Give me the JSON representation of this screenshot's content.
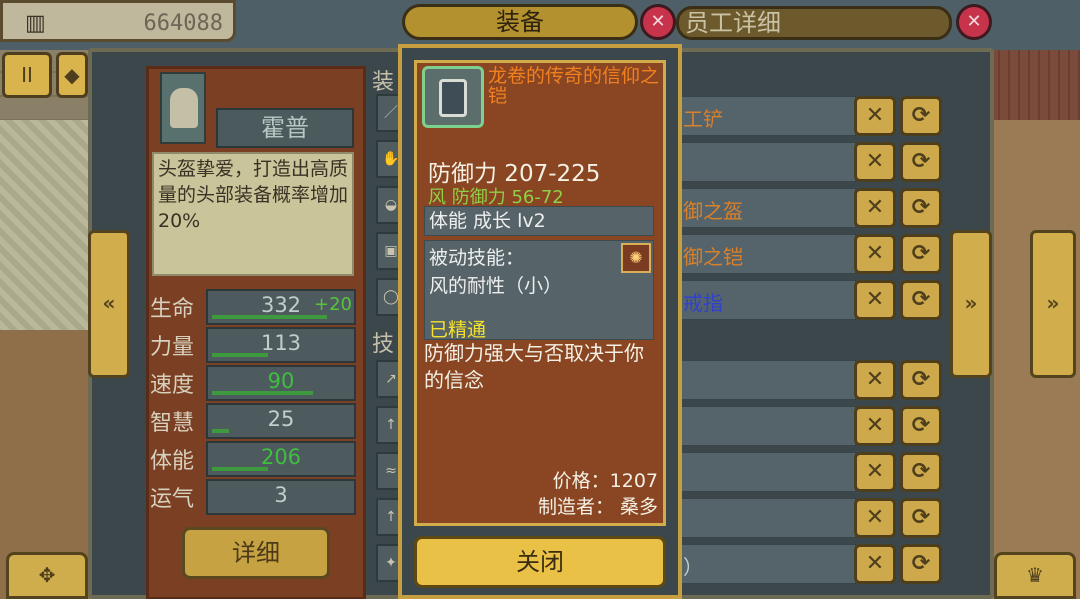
{
  "top": {
    "money": "664088",
    "bank_icon": "▥"
  },
  "titles": {
    "equipment": "装备",
    "employee_detail": "员工详细",
    "close_glyph": "✕"
  },
  "employee": {
    "name": "霍普",
    "description": "头盔挚爱，打造出高质量的头部装备概率增加20%",
    "stats": [
      {
        "label": "生命",
        "value": "332",
        "bonus": "+20",
        "fill": 0.82,
        "value_color": "#c3cdca"
      },
      {
        "label": "力量",
        "value": "113",
        "bonus": "",
        "fill": 0.4,
        "value_color": "#c3cdca"
      },
      {
        "label": "速度",
        "value": "90",
        "bonus": "",
        "fill": 0.72,
        "value_color": "#3fbf3f"
      },
      {
        "label": "智慧",
        "value": "25",
        "bonus": "",
        "fill": 0.12,
        "value_color": "#c3cdca"
      },
      {
        "label": "体能",
        "value": "206",
        "bonus": "",
        "fill": 0.4,
        "value_color": "#3fbf3f"
      },
      {
        "label": "运气",
        "value": "3",
        "bonus": "",
        "fill": 0.0,
        "value_color": "#c3cdca"
      }
    ],
    "detail_button": "详细"
  },
  "middle": {
    "equip_header": "装",
    "skill_header": "技"
  },
  "list_rows": [
    {
      "text": "工铲",
      "color": "#d9802a"
    },
    {
      "text": "",
      "color": "#d9802a"
    },
    {
      "text": "御之盔",
      "color": "#d9802a"
    },
    {
      "text": "御之铠",
      "color": "#d9802a"
    },
    {
      "text": "戒指",
      "color": "#3040d0"
    },
    {
      "text": "",
      "color": "#c3cdca"
    },
    {
      "text": "",
      "color": "#c3cdca"
    },
    {
      "text": "",
      "color": "#c3cdca"
    },
    {
      "text": "",
      "color": "#c3cdca"
    },
    {
      "text": "）",
      "color": "#c3cdca"
    }
  ],
  "icons": {
    "remove": "✕",
    "swap": "⟳",
    "left_arrows": "«",
    "right_arrows": "»",
    "dpad": "✥",
    "crown": "♛"
  },
  "item": {
    "name": "龙卷的传奇的信仰之铠",
    "defense": "防御力 207-225",
    "wind_defense": "风 防御力 56-72",
    "growth": "体能 成长 lv2",
    "skill_title": "被动技能：",
    "skill_name": "风的耐性（小）",
    "skill_status": "已精通",
    "flavor": "防御力强大与否取决于你的信念",
    "price": "价格：1207",
    "maker": "制造者： 桑多",
    "close_button": "关闭"
  }
}
